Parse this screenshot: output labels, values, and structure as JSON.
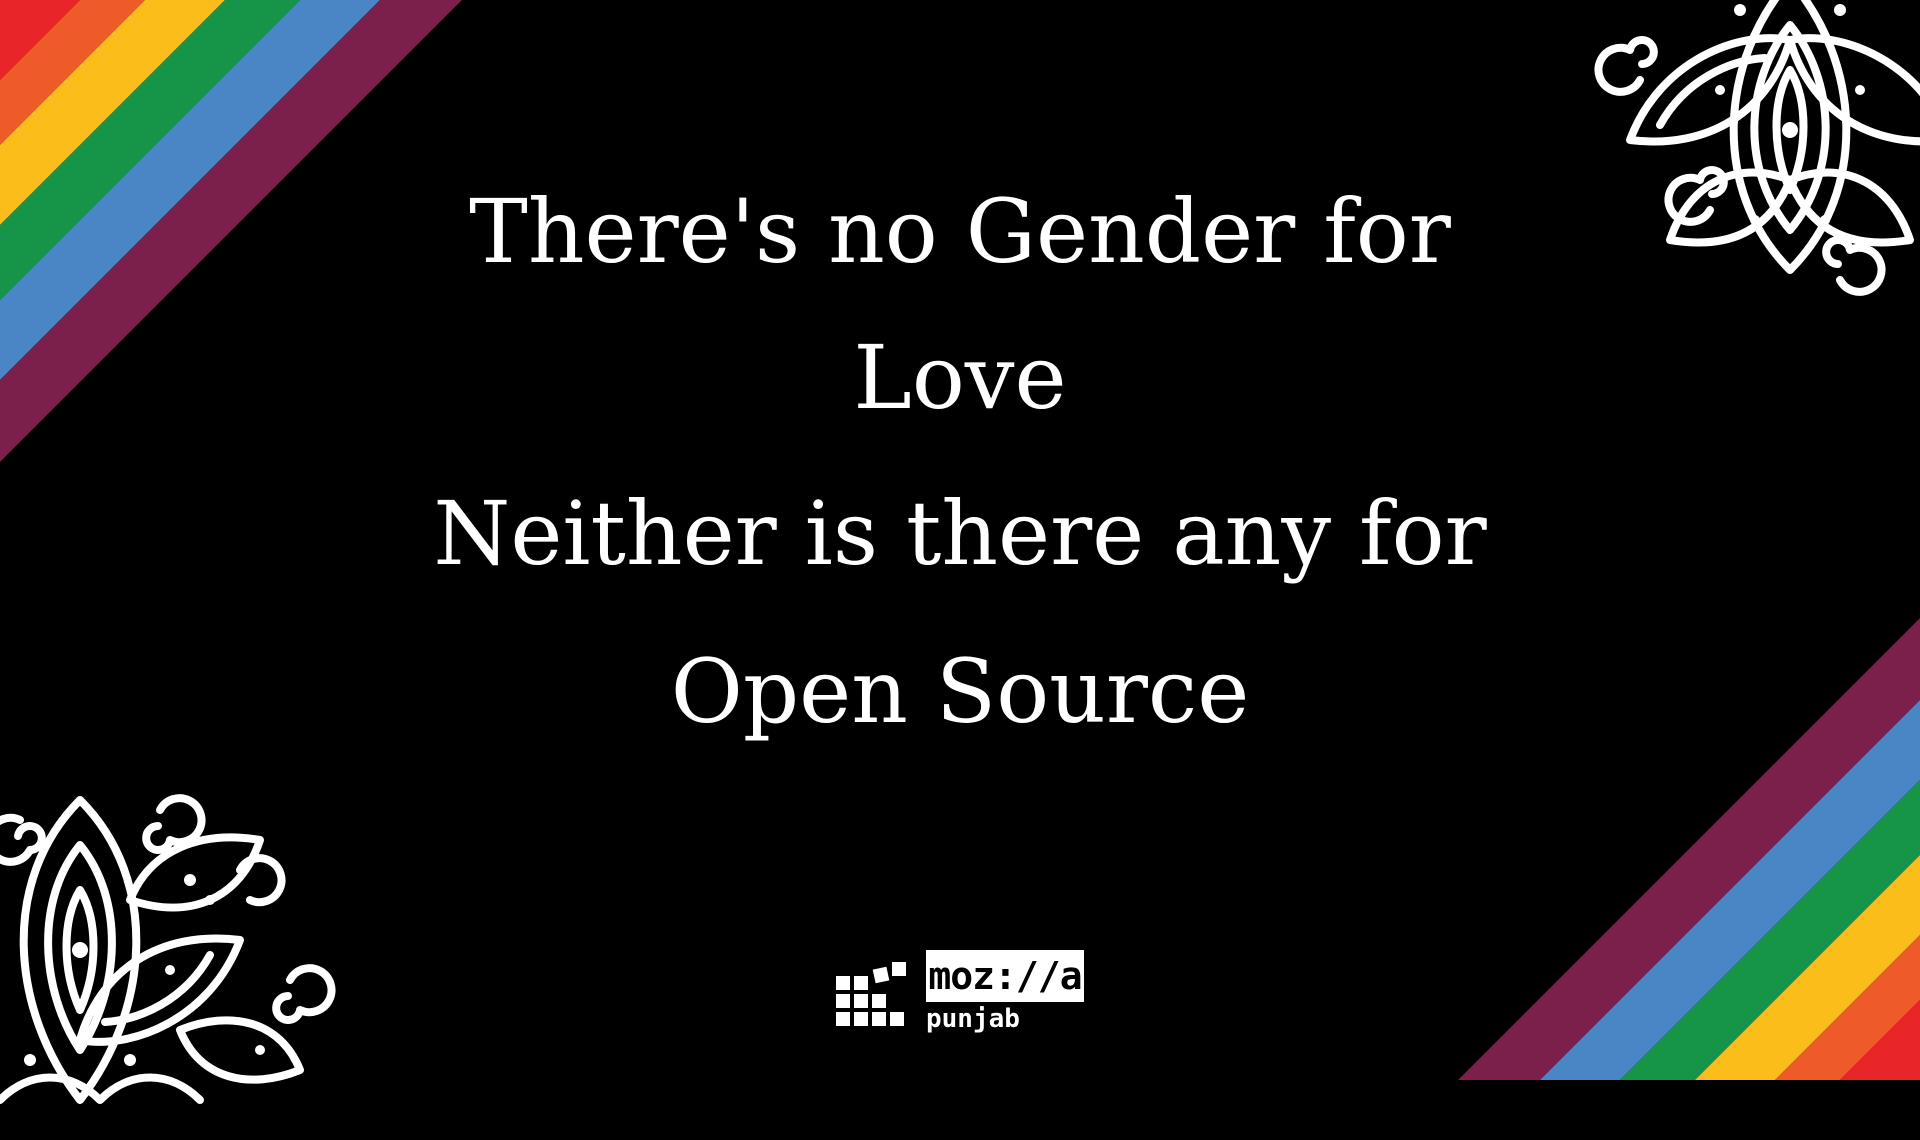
{
  "headline": {
    "line1": "There's no Gender for",
    "line2": "Love",
    "line3": "Neither is there any for",
    "line4": "Open Source"
  },
  "logo": {
    "wordmark": "moz://a",
    "subtitle": "punjab"
  },
  "decoration": {
    "rainbow_colors": [
      "#e8262a",
      "#ee5a2a",
      "#fbbd1a",
      "#169447",
      "#4a86c6",
      "#7b1f4b"
    ],
    "background": "#000000",
    "ornament_color": "#ffffff",
    "icons": [
      "mandala-icon",
      "mozilla-grid-icon"
    ]
  }
}
